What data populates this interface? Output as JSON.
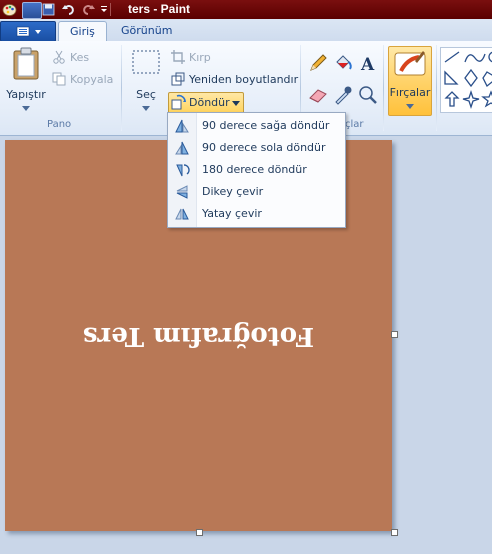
{
  "window": {
    "title": "ters - Paint"
  },
  "tabs": {
    "home": "Giriş",
    "view": "Görünüm"
  },
  "clipboard": {
    "paste": "Yapıştır",
    "cut": "Kes",
    "copy": "Kopyala",
    "group": "Pano"
  },
  "image": {
    "select": "Seç",
    "crop": "Kırp",
    "resize": "Yeniden boyutlandır",
    "rotate": "Döndür"
  },
  "tools": {
    "group_partial": "çlar"
  },
  "brushes": {
    "label": "Fırçalar"
  },
  "rotate_menu": {
    "items": [
      {
        "label": "90 derece sağa döndür"
      },
      {
        "label": "90 derece sola döndür"
      },
      {
        "label": "180 derece döndür"
      },
      {
        "label": "Dikey çevir"
      },
      {
        "label": "Yatay çevir"
      }
    ]
  },
  "canvas": {
    "text": "Fotoğrafım Ters",
    "color": "#b87856"
  },
  "icons": {
    "app": "paint-app-icon",
    "save": "save-icon",
    "undo": "undo-icon",
    "redo": "redo-icon",
    "paste": "clipboard-icon",
    "cut": "scissors-icon",
    "copy": "copy-icon",
    "select": "select-rectangle-icon",
    "crop": "crop-icon",
    "resize": "resize-icon",
    "rotate": "rotate-icon",
    "pencil": "pencil-icon",
    "fill": "fill-bucket-icon",
    "text": "text-icon",
    "eraser": "eraser-icon",
    "picker": "color-picker-icon",
    "magnifier": "magnifier-icon",
    "brush": "brush-icon",
    "shapes": "shapes-icon"
  }
}
